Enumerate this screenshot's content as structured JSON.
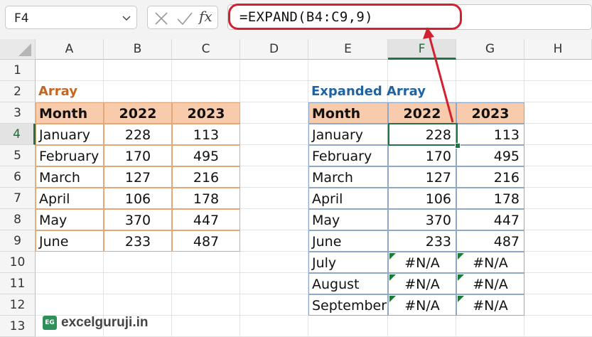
{
  "formula_bar": {
    "name_box": "F4",
    "cancel_icon": "cross-icon",
    "enter_icon": "checkmark-icon",
    "fx_label": "fx",
    "formula": "=EXPAND(B4:C9,9)"
  },
  "columns": [
    "A",
    "B",
    "C",
    "D",
    "E",
    "F",
    "G",
    "H"
  ],
  "rows": [
    "1",
    "2",
    "3",
    "4",
    "5",
    "6",
    "7",
    "8",
    "9",
    "10",
    "11",
    "12",
    "13"
  ],
  "selected_cell": {
    "column": "F",
    "row": "4"
  },
  "left_table": {
    "title": "Array",
    "headers": [
      "Month",
      "2022",
      "2023"
    ],
    "rows": [
      [
        "January",
        "228",
        "113"
      ],
      [
        "February",
        "170",
        "495"
      ],
      [
        "March",
        "127",
        "216"
      ],
      [
        "April",
        "106",
        "178"
      ],
      [
        "May",
        "370",
        "447"
      ],
      [
        "June",
        "233",
        "487"
      ]
    ]
  },
  "right_table": {
    "title": "Expanded Array",
    "headers": [
      "Month",
      "2022",
      "2023"
    ],
    "rows": [
      [
        "January",
        "228",
        "113"
      ],
      [
        "February",
        "170",
        "495"
      ],
      [
        "March",
        "127",
        "216"
      ],
      [
        "April",
        "106",
        "178"
      ],
      [
        "May",
        "370",
        "447"
      ],
      [
        "June",
        "233",
        "487"
      ],
      [
        "July",
        "#N/A",
        "#N/A"
      ],
      [
        "August",
        "#N/A",
        "#N/A"
      ],
      [
        "September",
        "#N/A",
        "#N/A"
      ]
    ]
  },
  "watermark": {
    "logo_text": "EG",
    "text": "excelguruji.in"
  },
  "colors": {
    "header_fill": "#f8cbad",
    "left_title": "#c5651e",
    "right_title": "#2063a5",
    "annotation": "#d1202f",
    "selection": "#217346"
  }
}
